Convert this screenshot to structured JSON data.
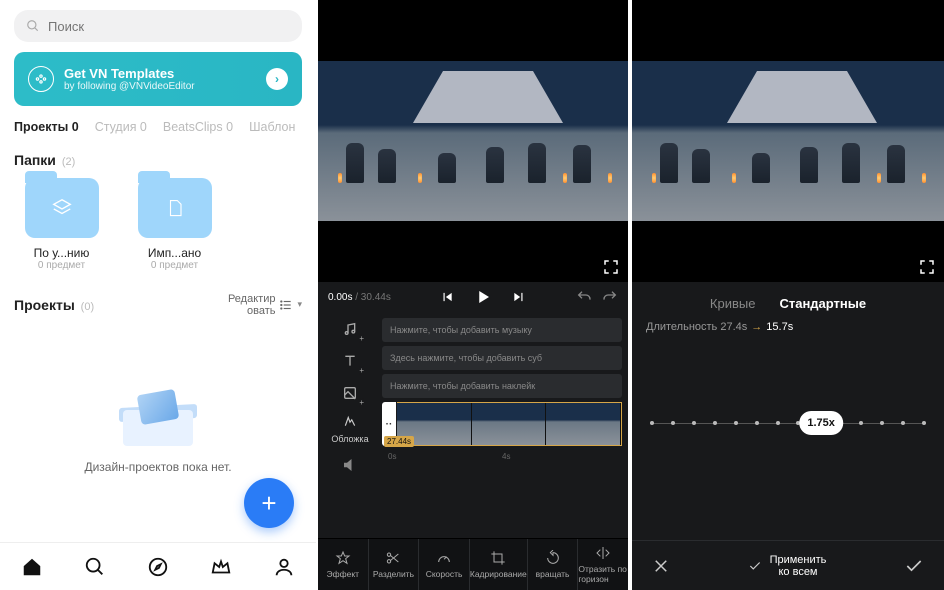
{
  "left": {
    "search_placeholder": "Поиск",
    "promo": {
      "title": "Get VN Templates",
      "sub": "by following @VNVideoEditor"
    },
    "tabs": [
      "Проекты 0",
      "Студия 0",
      "BeatsClips 0",
      "Шаблон"
    ],
    "folders_head": "Папки",
    "folders_count": "(2)",
    "folders": [
      {
        "name": "По у...нию",
        "sub": "0 предмет"
      },
      {
        "name": "Имп...ано",
        "sub": "0 предмет"
      }
    ],
    "projects_head": "Проекты",
    "projects_count": "(0)",
    "edit_label": "Редактир\nовать",
    "empty_text": "Дизайн-проектов пока нет."
  },
  "mid": {
    "time_current": "0.00s",
    "time_total": "/ 30.44s",
    "hints": [
      "Нажмите, чтобы добавить музыку",
      "Здесь нажмите, чтобы добавить суб",
      "Нажмите, чтобы добавить наклейк"
    ],
    "cover_label": "Обложка",
    "clip_time": "27.44s",
    "ruler": {
      "a": "0s",
      "b": "4s"
    },
    "toolbar": [
      "Эффект",
      "Разделить",
      "Скорость",
      "Кадрирование",
      "вращать",
      "Отразить по горизон"
    ]
  },
  "right": {
    "tabs": {
      "curves": "Кривые",
      "standard": "Стандартные"
    },
    "duration_label": "Длительность",
    "dur_from": "27.4s",
    "dur_to": "15.7s",
    "speed_value": "1.75x",
    "apply_all": "Применить\nко всем"
  }
}
